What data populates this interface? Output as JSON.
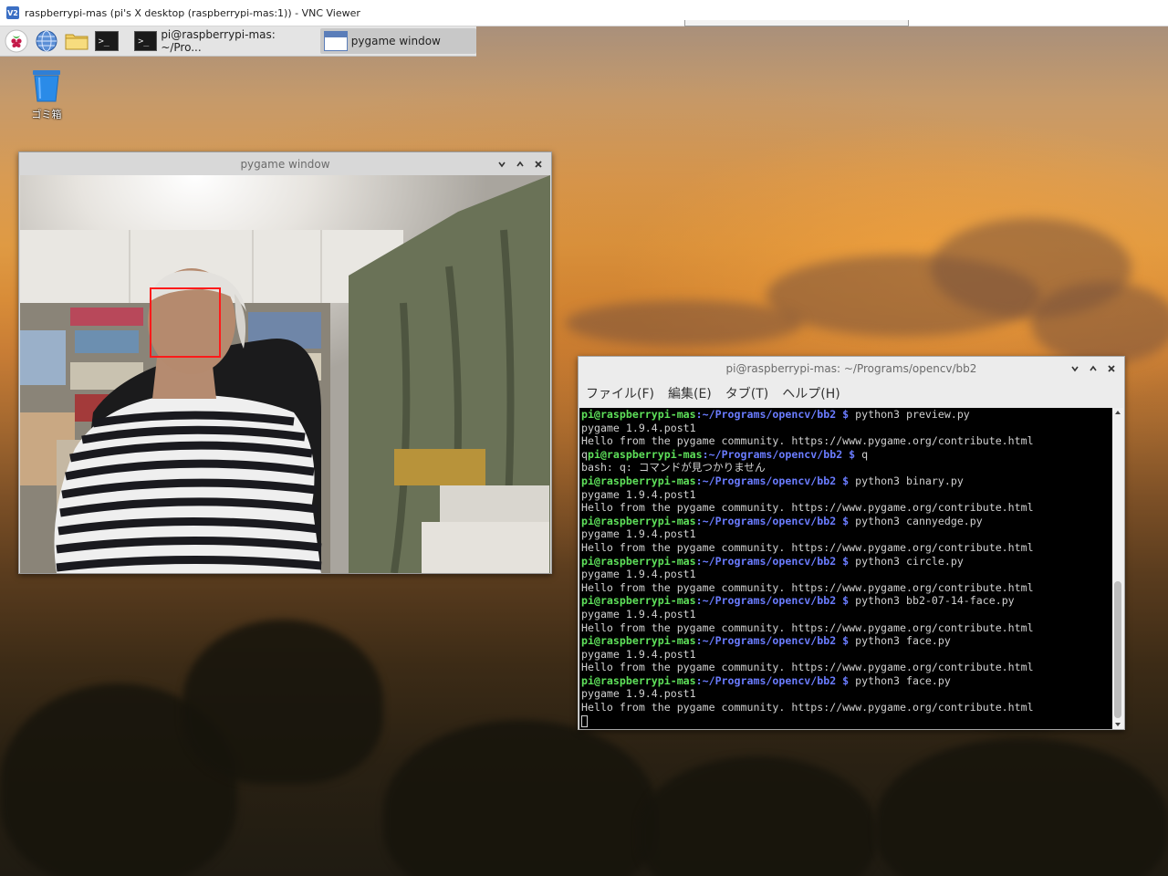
{
  "vnc": {
    "logo": "V2",
    "title": "raspberrypi-mas (pi's X desktop (raspberrypi-mas:1)) - VNC Viewer"
  },
  "taskbar": {
    "launchers": [
      {
        "icon": "raspberry-menu-icon"
      },
      {
        "icon": "web-browser-globe-icon"
      },
      {
        "icon": "file-manager-folder-icon"
      },
      {
        "icon": "terminal-icon",
        "glyph": ">_"
      }
    ],
    "tasks": [
      {
        "label": "pi@raspberrypi-mas: ~/Pro...",
        "glyph": ">_",
        "active": false
      },
      {
        "label": "pygame window",
        "active": true
      }
    ]
  },
  "desktop": {
    "trash_label": "ゴミ箱"
  },
  "pygame_window": {
    "title": "pygame window",
    "controls": [
      "⌄",
      "⌃",
      "✕"
    ]
  },
  "terminal_window": {
    "title": "pi@raspberrypi-mas: ~/Programs/opencv/bb2",
    "controls": [
      "⌄",
      "⌃",
      "✕"
    ],
    "menu": [
      "ファイル(F)",
      "編集(E)",
      "タブ(T)",
      "ヘルプ(H)"
    ],
    "prompt_user": "pi@raspberrypi-mas",
    "prompt_path": ":~/Programs/opencv/bb2 $",
    "lines": [
      {
        "type": "prompt",
        "cmd": " python3 preview.py"
      },
      {
        "type": "out",
        "text": "pygame 1.9.4.post1"
      },
      {
        "type": "out",
        "text": "Hello from the pygame community. https://www.pygame.org/contribute.html"
      },
      {
        "type": "prompt",
        "pre": "q",
        "cmd": " q"
      },
      {
        "type": "out",
        "text": "bash: q: コマンドが見つかりません"
      },
      {
        "type": "prompt",
        "cmd": " python3 binary.py"
      },
      {
        "type": "out",
        "text": "pygame 1.9.4.post1"
      },
      {
        "type": "out",
        "text": "Hello from the pygame community. https://www.pygame.org/contribute.html"
      },
      {
        "type": "prompt",
        "cmd": " python3 cannyedge.py"
      },
      {
        "type": "out",
        "text": "pygame 1.9.4.post1"
      },
      {
        "type": "out",
        "text": "Hello from the pygame community. https://www.pygame.org/contribute.html"
      },
      {
        "type": "prompt",
        "cmd": " python3 circle.py"
      },
      {
        "type": "out",
        "text": "pygame 1.9.4.post1"
      },
      {
        "type": "out",
        "text": "Hello from the pygame community. https://www.pygame.org/contribute.html"
      },
      {
        "type": "prompt",
        "cmd": " python3 bb2-07-14-face.py"
      },
      {
        "type": "out",
        "text": "pygame 1.9.4.post1"
      },
      {
        "type": "out",
        "text": "Hello from the pygame community. https://www.pygame.org/contribute.html"
      },
      {
        "type": "prompt",
        "cmd": " python3 face.py"
      },
      {
        "type": "out",
        "text": "pygame 1.9.4.post1"
      },
      {
        "type": "out",
        "text": "Hello from the pygame community. https://www.pygame.org/contribute.html"
      },
      {
        "type": "prompt",
        "cmd": " python3 face.py"
      },
      {
        "type": "out",
        "text": "pygame 1.9.4.post1"
      },
      {
        "type": "out",
        "text": "Hello from the pygame community. https://www.pygame.org/contribute.html"
      },
      {
        "type": "cursor"
      }
    ]
  },
  "colors": {
    "prompt_user": "#5ee05a",
    "prompt_path": "#6a7cff",
    "face_box": "#ff1a1a"
  }
}
